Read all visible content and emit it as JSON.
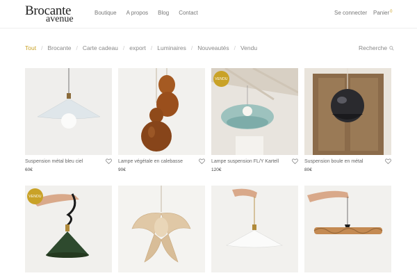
{
  "brand": {
    "line1": "Brocante",
    "line2": "avenue"
  },
  "nav": [
    "Boutique",
    "A propos",
    "Blog",
    "Contact"
  ],
  "account": {
    "login": "Se connecter",
    "cart": "Panier",
    "cart_count": "0"
  },
  "filters": {
    "items": [
      "Tout",
      "Brocante",
      "Carte cadeau",
      "export",
      "Luminaires",
      "Nouveautés",
      "Vendu"
    ],
    "active": "Tout"
  },
  "search": {
    "label": "Recherche"
  },
  "colors": {
    "accent": "#c9a227"
  },
  "products": [
    {
      "name": "Suspension métal bleu ciel",
      "price": "60€",
      "sold": false,
      "badge": ""
    },
    {
      "name": "Lampe végétale en calebasse",
      "price": "90€",
      "sold": false,
      "badge": ""
    },
    {
      "name": "Lampe suspension FL/Y Kartell",
      "price": "120€",
      "sold": true,
      "badge": "VENDU"
    },
    {
      "name": "Suspension boule en métal",
      "price": "80€",
      "sold": false,
      "badge": ""
    },
    {
      "name": "",
      "price": "",
      "sold": true,
      "badge": "VENDU"
    },
    {
      "name": "",
      "price": "",
      "sold": false,
      "badge": ""
    },
    {
      "name": "",
      "price": "",
      "sold": false,
      "badge": ""
    },
    {
      "name": "",
      "price": "",
      "sold": false,
      "badge": ""
    }
  ]
}
